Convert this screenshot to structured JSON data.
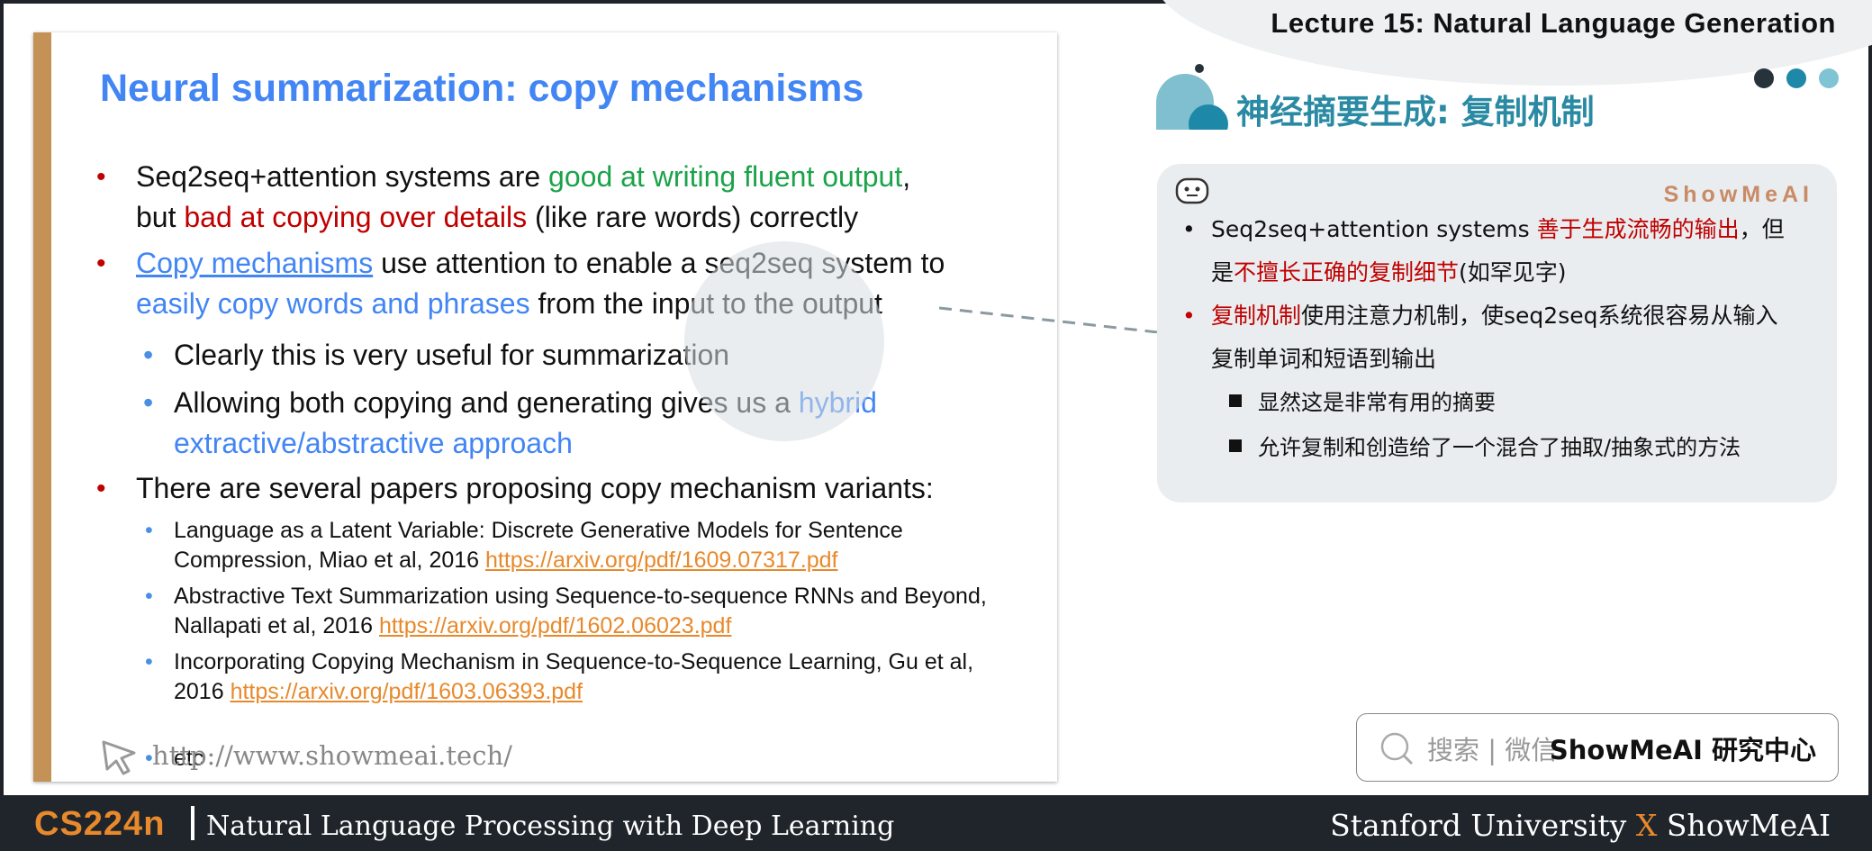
{
  "header": {
    "lecture_title": "Lecture 15: Natural Language Generation",
    "dot_colors": [
      "#26333b",
      "#1e88a8",
      "#7fc4d4"
    ]
  },
  "slide": {
    "title": "Neural summarization: copy mechanisms",
    "bullet1": {
      "a": "Seq2seq+attention systems are ",
      "b": "good at writing fluent output",
      "c": ",",
      "d": "but ",
      "e": "bad at copying over details",
      "f": " (like rare words) correctly"
    },
    "bullet2": {
      "a": "Copy mechanisms",
      "b": " use attention to enable a seq2seq system to",
      "c": "easily copy words and phrases",
      "d": " from the input to the output"
    },
    "sub1": "Clearly this is very useful for summarization",
    "sub2": {
      "a": "Allowing both copying and generating gives us a ",
      "b": "hybrid",
      "c": "extractive/abstractive approach"
    },
    "bullet3": "There are several papers proposing copy mechanism variants:",
    "papers": [
      {
        "line1": "Language as a Latent Variable: Discrete Generative Models for Sentence",
        "line2": "Compression, Miao et al, 2016 ",
        "link": "https://arxiv.org/pdf/1609.07317.pdf"
      },
      {
        "line1": "Abstractive Text Summarization using Sequence-to-sequence RNNs and Beyond,",
        "line2": "Nallapati et al, 2016 ",
        "link": "https://arxiv.org/pdf/1602.06023.pdf"
      },
      {
        "line1": "Incorporating Copying Mechanism in Sequence-to-Sequence Learning, Gu et al,",
        "line2": "2016 ",
        "link": "https://arxiv.org/pdf/1603.06393.pdf"
      }
    ],
    "etc": "etc",
    "url": "http://www.showmeai.tech/",
    "bullet_mark": "•",
    "accent_color": "#c49257"
  },
  "notes": {
    "title": "神经摘要生成: 复制机制",
    "brand": "ShowMeAI",
    "line1": {
      "a": "Seq2seq+attention systems ",
      "b": "善于生成流畅的输出",
      "c": "，但"
    },
    "line2": {
      "a": "是",
      "b": "不擅长正确的复制细节",
      "c": "(如罕见字)"
    },
    "line3": {
      "a": "复制机制",
      "b": "使用注意力机制，使seq2seq系统很容易从输入"
    },
    "line4": "复制单词和短语到输出",
    "line5": "显然这是非常有用的摘要",
    "line6": "允许复制和创造给了一个混合了抽取/抽象式的方法",
    "bullet_mark": "•"
  },
  "search": {
    "label": "搜索 | 微信",
    "brand": "ShowMeAI 研究中心"
  },
  "footer": {
    "course": "CS224n",
    "description": "Natural Language Processing with Deep Learning",
    "left_brand": "Stanford University",
    "x": "X",
    "right_brand": "ShowMeAI"
  }
}
